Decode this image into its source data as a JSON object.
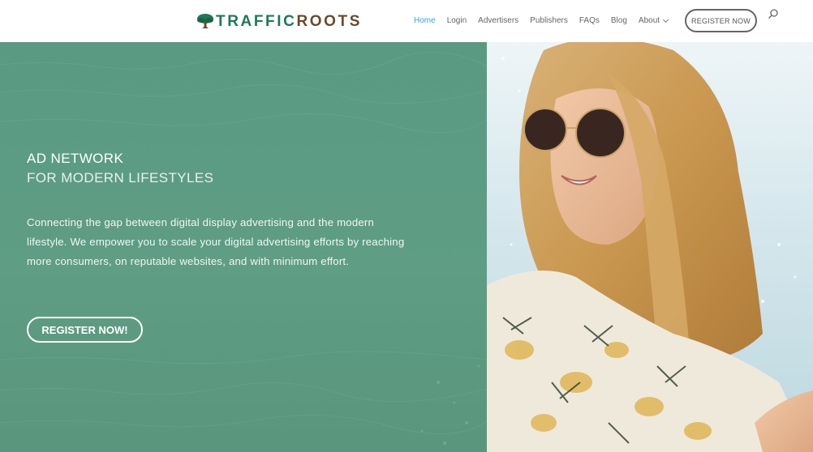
{
  "brand": {
    "name_part1": "TRAFFIC",
    "name_part2": "ROOTS",
    "colors": {
      "traffic": "#1e7a55",
      "roots": "#6a4a2a"
    }
  },
  "nav": {
    "items": [
      {
        "label": "Home",
        "active": true
      },
      {
        "label": "Login"
      },
      {
        "label": "Advertisers"
      },
      {
        "label": "Publishers"
      },
      {
        "label": "FAQs"
      },
      {
        "label": "Blog"
      },
      {
        "label": "About",
        "dropdown": true
      }
    ],
    "register_label": "REGISTER NOW",
    "search_icon": "search-icon"
  },
  "hero": {
    "heading_line1": "AD NETWORK",
    "heading_line2": "FOR MODERN LIFESTYLES",
    "description": "Connecting the gap between digital display advertising and the modern lifestyle. We empower you to scale your digital advertising efforts by reaching more consumers, on reputable websites, and with minimum effort.",
    "cta_label": "REGISTER NOW!",
    "overlay_color": "#5e9c84",
    "accent_color": "#2ea3f2"
  }
}
